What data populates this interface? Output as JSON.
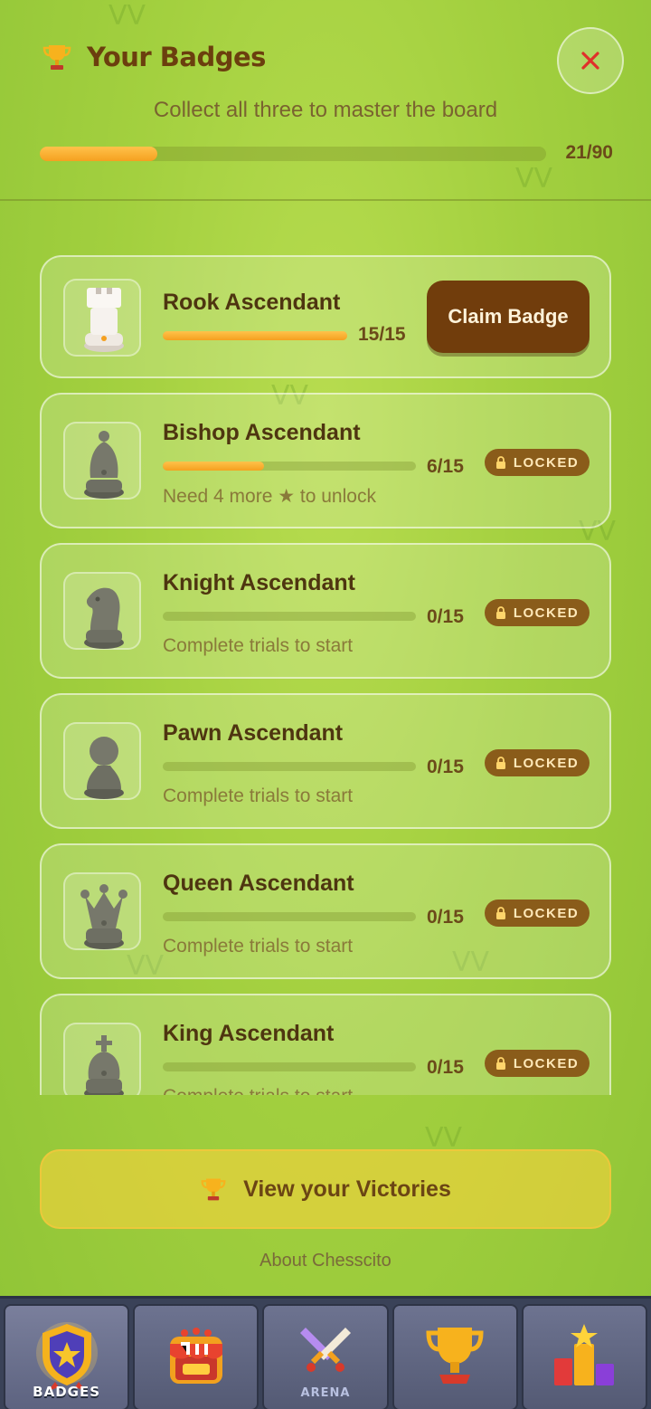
{
  "header": {
    "title": "Your Badges",
    "subtitle": "Collect all three to master the board",
    "progress": 0.233,
    "count": "21/90",
    "close_icon": "close-icon"
  },
  "badges": [
    {
      "name": "Rook Ascendant",
      "count": "15/15",
      "progress": 1.0,
      "action": "Claim Badge",
      "icon": "rook-piece-icon"
    },
    {
      "name": "Bishop Ascendant",
      "count": "6/15",
      "progress": 0.4,
      "status": "LOCKED",
      "hint": "Need 4 more ★ to unlock",
      "icon": "bishop-piece-icon"
    },
    {
      "name": "Knight Ascendant",
      "count": "0/15",
      "progress": 0,
      "status": "LOCKED",
      "hint": "Complete trials to start",
      "icon": "knight-piece-icon"
    },
    {
      "name": "Pawn Ascendant",
      "count": "0/15",
      "progress": 0,
      "status": "LOCKED",
      "hint": "Complete trials to start",
      "icon": "pawn-piece-icon"
    },
    {
      "name": "Queen Ascendant",
      "count": "0/15",
      "progress": 0,
      "status": "LOCKED",
      "hint": "Complete trials to start",
      "icon": "queen-piece-icon"
    },
    {
      "name": "King Ascendant",
      "count": "0/15",
      "progress": 0,
      "status": "LOCKED",
      "hint": "Complete trials to start",
      "icon": "king-piece-icon"
    }
  ],
  "victories_button": "View your Victories",
  "about_link": "About Chesscito",
  "nav": [
    {
      "label": "BADGES",
      "icon": "badge-shield-icon",
      "active": true
    },
    {
      "label": "",
      "icon": "shop-icon",
      "active": false
    },
    {
      "label": "ARENA",
      "icon": "crossed-swords-icon",
      "active": false
    },
    {
      "label": "",
      "icon": "trophy-icon",
      "active": false
    },
    {
      "label": "",
      "icon": "leaderboard-podium-icon",
      "active": false
    }
  ],
  "colors": {
    "accent_orange": "#f5a020",
    "claim_brown": "#713d0c",
    "locked_brown": "#8a5c1a",
    "close_red": "#e0302a"
  }
}
